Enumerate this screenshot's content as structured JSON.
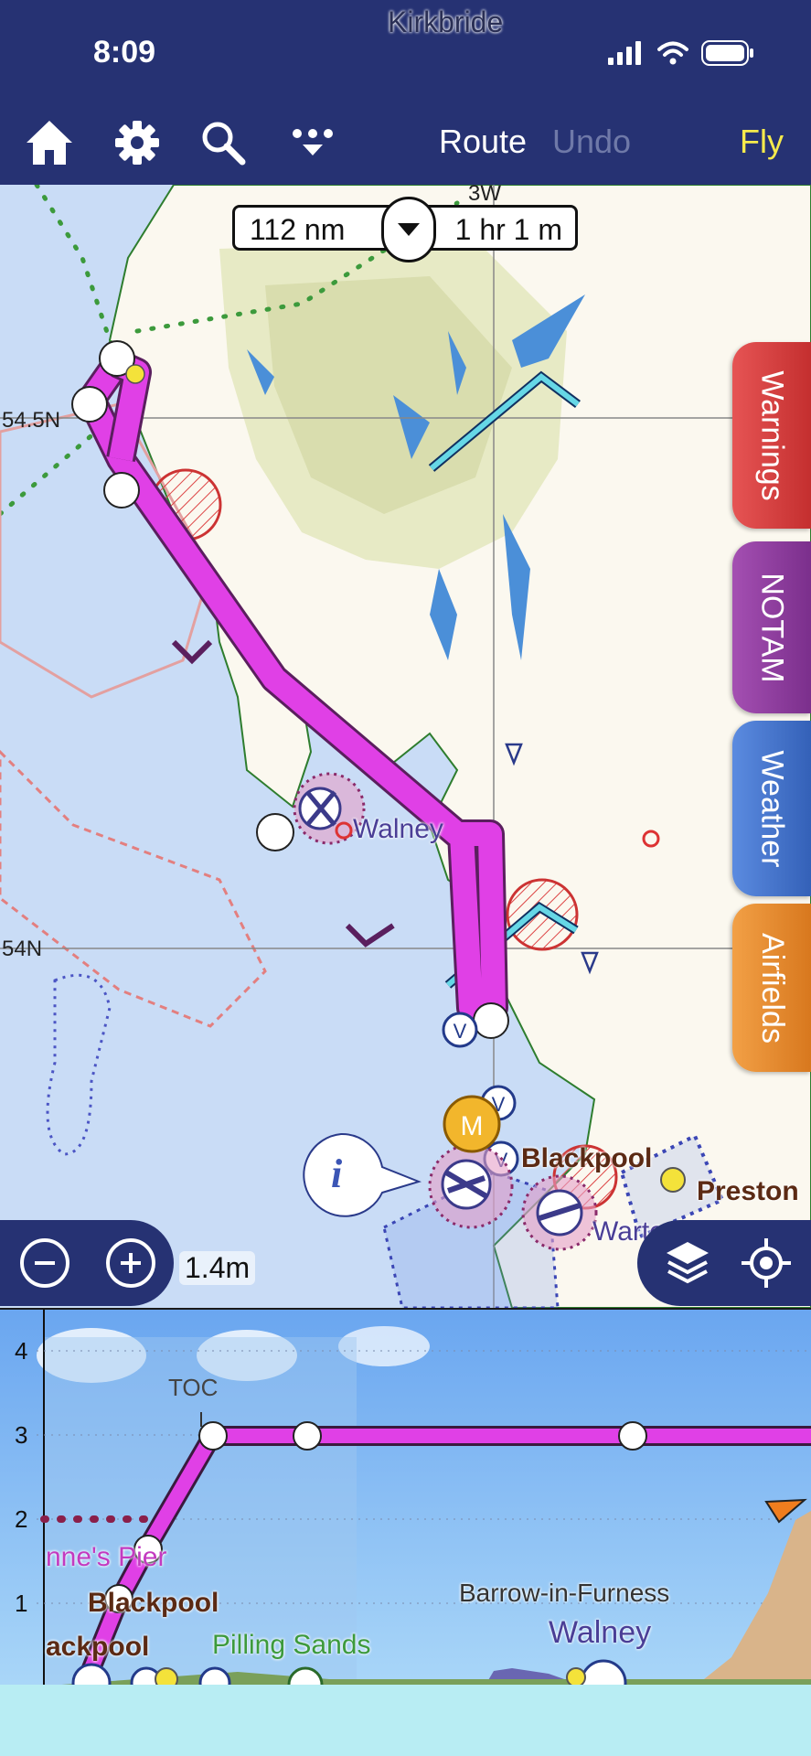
{
  "status_bar": {
    "time": "8:09"
  },
  "toolbar": {
    "icons": [
      "home-icon",
      "gear-icon",
      "search-icon",
      "more-icon"
    ],
    "route_label": "Route",
    "undo_label": "Undo",
    "fly_label": "Fly"
  },
  "map": {
    "route_info": {
      "distance": "112 nm",
      "duration": "1 hr 1 m"
    },
    "lat_labels": [
      "54.5N",
      "54N"
    ],
    "lon_label": "3W",
    "places": [
      "Kirkbride",
      "Walney",
      "Blackpool",
      "Preston",
      "Warton"
    ],
    "side_tabs": [
      {
        "label": "Warnings",
        "color": "#d63c3c"
      },
      {
        "label": "NOTAM",
        "color": "#8e3b9c"
      },
      {
        "label": "Weather",
        "color": "#3f6fc6"
      },
      {
        "label": "Airfields",
        "color": "#e38a2c"
      }
    ],
    "scale": "1.4m",
    "waypoint_marker": "M",
    "info_icon": "i",
    "colors": {
      "route": "#e040e6",
      "toolbar": "#263273",
      "fly": "#f6ea4c"
    }
  },
  "profile": {
    "y_labels": [
      "4",
      "3",
      "2",
      "1"
    ],
    "toc_label": "TOC",
    "labels": [
      "nne's Pier",
      "Blackpool",
      "ackpool",
      "Pilling Sands",
      "Barrow-in-Furness",
      "Walney"
    ]
  }
}
